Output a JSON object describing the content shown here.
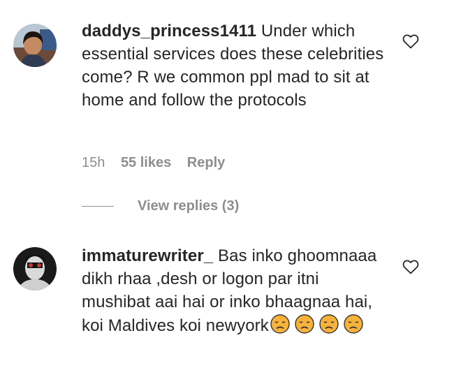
{
  "comments": [
    {
      "username": "daddys_princess1411",
      "text": "Under which essential services does these celebrities come? R we common ppl mad to sit at home and follow the protocols",
      "time": "15h",
      "likes": "55 likes",
      "reply_label": "Reply",
      "view_replies": "View replies (3)"
    },
    {
      "username": "immaturewriter_",
      "text": "Bas inko ghoomnaaa dikh rhaa ,desh or logon par itni mushibat aai hai or inko bhaagnaa hai, koi Maldives koi newyork",
      "emojis": [
        "disappointed-face",
        "disappointed-face",
        "disappointed-face",
        "disappointed-face"
      ]
    }
  ],
  "icons": {
    "like": "heart-icon",
    "emoji": "disappointed-face"
  },
  "colors": {
    "text": "#262626",
    "secondary": "#8e8e8e",
    "emoji_fill": "#f7b23b"
  }
}
